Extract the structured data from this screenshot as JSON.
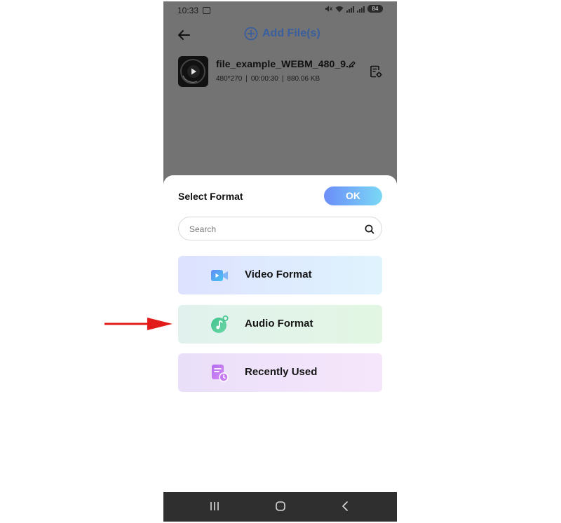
{
  "status_bar": {
    "time": "10:33",
    "battery": "84"
  },
  "header": {
    "back_icon": "arrow-left-icon",
    "add_files_label": "Add File(s)",
    "add_icon": "plus-circle-icon"
  },
  "file": {
    "name": "file_example_WEBM_480_9...",
    "resolution": "480*270",
    "duration": "00:00:30",
    "size": "880.06 KB"
  },
  "sheet": {
    "title": "Select Format",
    "ok_label": "OK",
    "search_placeholder": "Search",
    "options": [
      {
        "label": "Video Format",
        "icon": "video-camera-icon"
      },
      {
        "label": "Audio Format",
        "icon": "music-note-icon"
      },
      {
        "label": "Recently Used",
        "icon": "recent-document-icon"
      }
    ]
  },
  "nav": {
    "recents_icon": "recents-icon",
    "home_icon": "home-icon",
    "back_icon": "nav-back-icon"
  },
  "colors": {
    "accent_blue": "#3a5f9e",
    "ok_gradient_start": "#6b8df8",
    "ok_gradient_end": "#7ad8f5",
    "annotation_arrow": "#e21b1b"
  }
}
